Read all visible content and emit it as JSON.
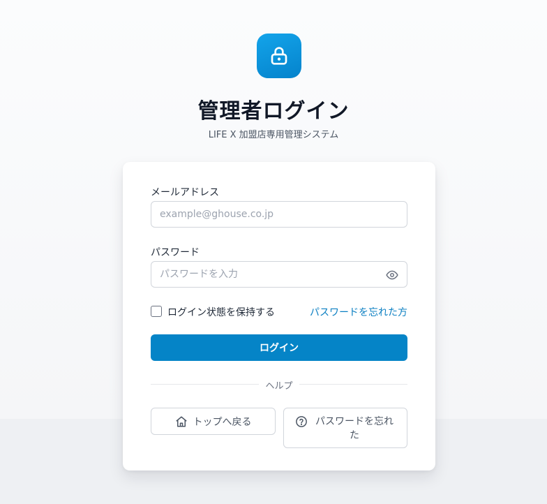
{
  "header": {
    "icon": "lock-icon",
    "title": "管理者ログイン",
    "subtitle": "LIFE X 加盟店専用管理システム"
  },
  "form": {
    "email_label": "メールアドレス",
    "email_placeholder": "example@ghouse.co.jp",
    "email_value": "",
    "password_label": "パスワード",
    "password_placeholder": "パスワードを入力",
    "password_value": "",
    "remember_label": "ログイン状態を保持する",
    "remember_checked": false,
    "forgot_link": "パスワードを忘れた方",
    "login_button": "ログイン"
  },
  "help": {
    "divider_label": "ヘルプ",
    "top_button": "トップへ戻る",
    "forgot_button": "パスワードを忘れた"
  },
  "colors": {
    "accent": "#0584c7",
    "link": "#0b7fc2",
    "badge_gradient_start": "#13a4ea",
    "badge_gradient_end": "#0583cc"
  }
}
